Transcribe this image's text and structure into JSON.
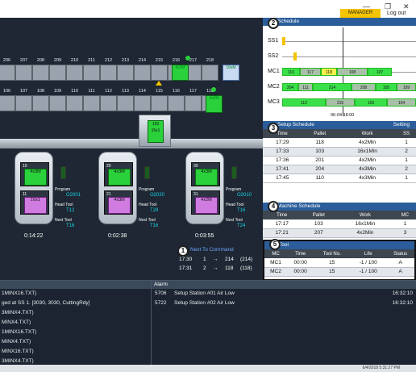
{
  "header": {
    "role_badge": "MANAGER",
    "logout_label": "Log out",
    "win_minimize": "—",
    "win_restore": "❐",
    "win_close": "✕"
  },
  "stocker": {
    "top_row": [
      {
        "num": "206"
      },
      {
        "num": "207"
      },
      {
        "num": "208"
      },
      {
        "num": "209"
      },
      {
        "num": "210"
      },
      {
        "num": "211"
      },
      {
        "num": "212"
      },
      {
        "num": "213"
      },
      {
        "num": "214"
      },
      {
        "num": "215"
      },
      {
        "num": "216"
      },
      {
        "num": "217"
      },
      {
        "num": "218"
      }
    ],
    "bottom_row": [
      {
        "num": "106"
      },
      {
        "num": "107"
      },
      {
        "num": "108"
      },
      {
        "num": "109"
      },
      {
        "num": "110"
      },
      {
        "num": "111"
      },
      {
        "num": "112"
      },
      {
        "num": "113"
      },
      {
        "num": "114"
      },
      {
        "num": "115"
      },
      {
        "num": "116"
      },
      {
        "num": "117"
      },
      {
        "num": "118"
      }
    ],
    "pallet_215": "4x3M",
    "pallet_218": "16xM",
    "pallet_118": "4x2M",
    "cart_label": "16x1",
    "cart_num": "103"
  },
  "machines": [
    {
      "slot_top_label": "10",
      "slot_top_work": "4x3M",
      "slot_bot_label": "11",
      "slot_bot_work": "16x1",
      "program_label": "Program",
      "program": "O2001",
      "head_tool_label": "Head Tool",
      "head_tool": "T12",
      "next_tool_label": "Next Tool",
      "next_tool": "T16",
      "timer": "0:14:22"
    },
    {
      "slot_top_label": "20",
      "slot_top_work": "4x3M",
      "slot_bot_label": "21",
      "slot_bot_work": "4x3M",
      "program_label": "Program",
      "program": "O2020",
      "head_tool_label": "Head Tool",
      "head_tool": "T28",
      "next_tool_label": "Next Tool",
      "next_tool": "T16",
      "timer": "0:02:38"
    },
    {
      "slot_top_label": "30",
      "slot_top_work": "4x3M",
      "slot_bot_label": "31",
      "slot_bot_work": "4x2M",
      "program_label": "Program",
      "program": "O2010",
      "head_tool_label": "Head Tool",
      "head_tool": "T16",
      "next_tool_label": "Next Tool",
      "next_tool": "T24",
      "timer": "0:03:55"
    }
  ],
  "commands": {
    "title": "Next To Command",
    "rows": [
      {
        "time": "17:30",
        "from": "1",
        "arrow": "→",
        "to": "214",
        "extra": "(214)"
      },
      {
        "time": "17:31",
        "from": "2",
        "arrow": "→",
        "to": "118",
        "extra": "(118)"
      }
    ]
  },
  "log": {
    "lines": [
      "1MINX16.TXT)",
      "ged at SS 1. [3030, 3030, CuttingRdy]",
      "3MINX4.TXT)",
      "MINX4.TXT)",
      "1MINX16.TXT)",
      "MINX4.TXT)",
      "MINX16.TXT)",
      "3MINX4.TXT)"
    ]
  },
  "alarm": {
    "title": "Alarm",
    "rows": [
      {
        "code": "5706",
        "text": "Setup Station #01 Air Low",
        "time": "16:32:10"
      },
      {
        "code": "5722",
        "text": "Setup Station #02 Air Low",
        "time": "16:32:10"
      }
    ]
  },
  "status": {
    "datetime": "6/4/2018 5:31:27 PM"
  },
  "panels": {
    "schedule_title": "Schedule",
    "schedule_badge": "2",
    "gantt_rows": [
      {
        "label": "SS1"
      },
      {
        "label": "SS2"
      },
      {
        "label": "MC1"
      },
      {
        "label": "MC2"
      },
      {
        "label": "MC3"
      }
    ],
    "mc1_bars": [
      "116",
      "117",
      "118",
      "108",
      "107"
    ],
    "mc2_bars": [
      "204",
      "111",
      "214",
      "208",
      "105",
      "109"
    ],
    "mc3_bars": [
      "112",
      "215",
      "103",
      "104"
    ],
    "gantt_time": "06-04 18:00",
    "setup_title": "Setup Schedule",
    "setup_badge": "3",
    "setup_setting": "Setting",
    "setup_cols": [
      "Time",
      "Pallet",
      "Work",
      "SS"
    ],
    "setup_rows": [
      [
        "17:29",
        "118",
        "4x2Min",
        "1"
      ],
      [
        "17:33",
        "103",
        "16x1Min",
        "2"
      ],
      [
        "17:36",
        "201",
        "4x2Min",
        "1"
      ],
      [
        "17:41",
        "204",
        "4x3Min",
        "2"
      ],
      [
        "17:45",
        "110",
        "4x3Min",
        "1"
      ]
    ],
    "machine_title": "Machine Schedule",
    "machine_badge": "4",
    "machine_cols": [
      "Time",
      "Pallet",
      "Work",
      "MC"
    ],
    "machine_rows": [
      [
        "17:17",
        "103",
        "16x1Min",
        "1"
      ],
      [
        "17:21",
        "207",
        "4x2Min",
        "3"
      ]
    ],
    "tool_title": "Tool",
    "tool_badge": "5",
    "tool_cols": [
      "MC",
      "Time",
      "Tool No.",
      "Life",
      "Status"
    ],
    "tool_rows": [
      [
        "MC1",
        "00:00",
        "15",
        "-1 / 100",
        "A"
      ],
      [
        "MC2",
        "00:00",
        "15",
        "-1 / 100",
        "A"
      ]
    ],
    "command_badge": "1"
  }
}
